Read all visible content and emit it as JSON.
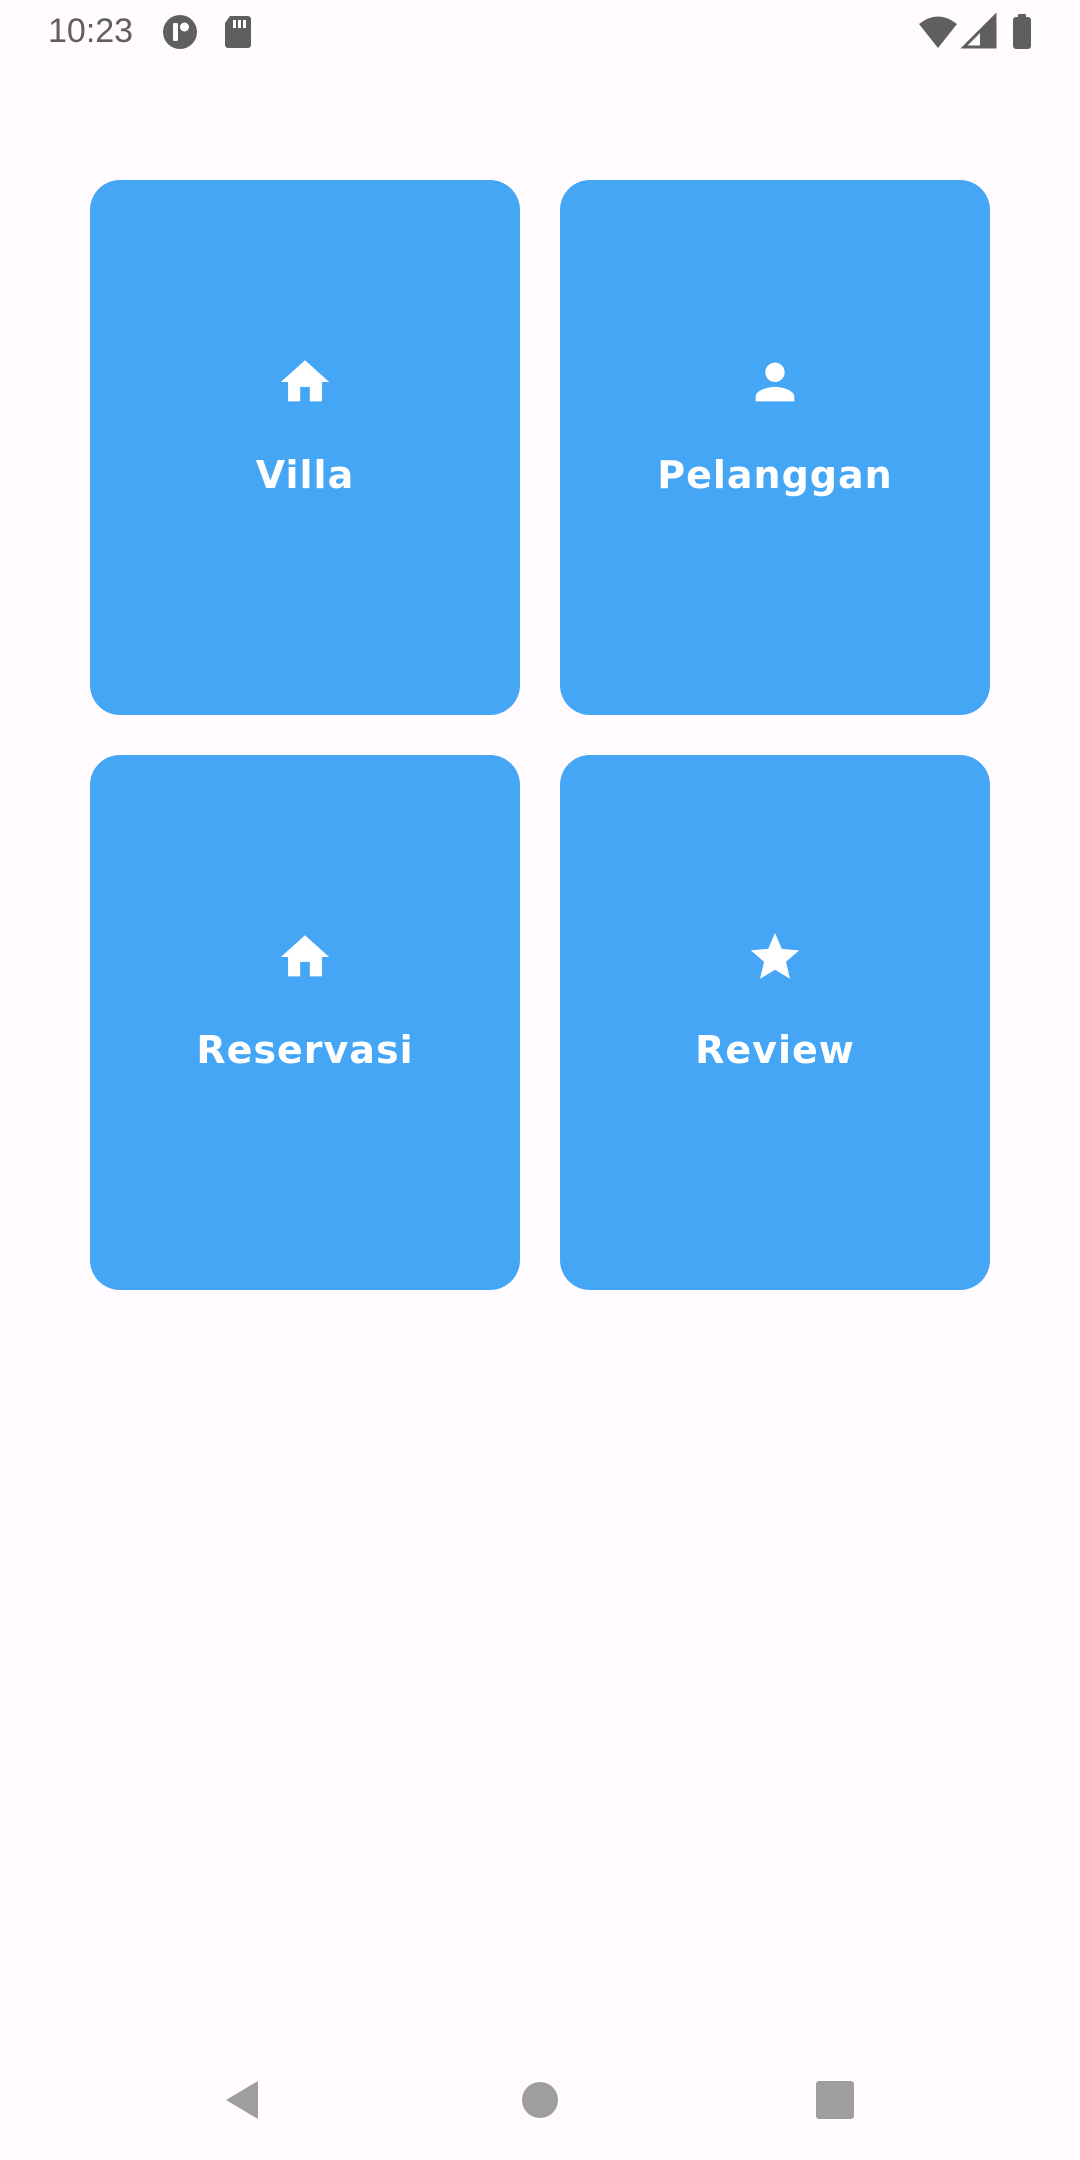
{
  "status_bar": {
    "time": "10:23",
    "icons": [
      "ring-app-icon",
      "sd-card-icon",
      "wifi-icon",
      "cell-signal-icon",
      "battery-icon"
    ]
  },
  "tiles": [
    {
      "label": "Villa",
      "icon": "home-icon"
    },
    {
      "label": "Pelanggan",
      "icon": "person-icon"
    },
    {
      "label": "Reservasi",
      "icon": "home-icon"
    },
    {
      "label": "Review",
      "icon": "star-icon"
    }
  ],
  "nav_bar": {
    "buttons": [
      "back-icon",
      "home-circle-icon",
      "recents-icon"
    ]
  },
  "colors": {
    "background": "#FFFBFE",
    "tile": "#45A6F6",
    "tile_text": "#FFFFFF",
    "status_icon": "#5F5F5F",
    "nav_icon": "#9E9E9E"
  }
}
